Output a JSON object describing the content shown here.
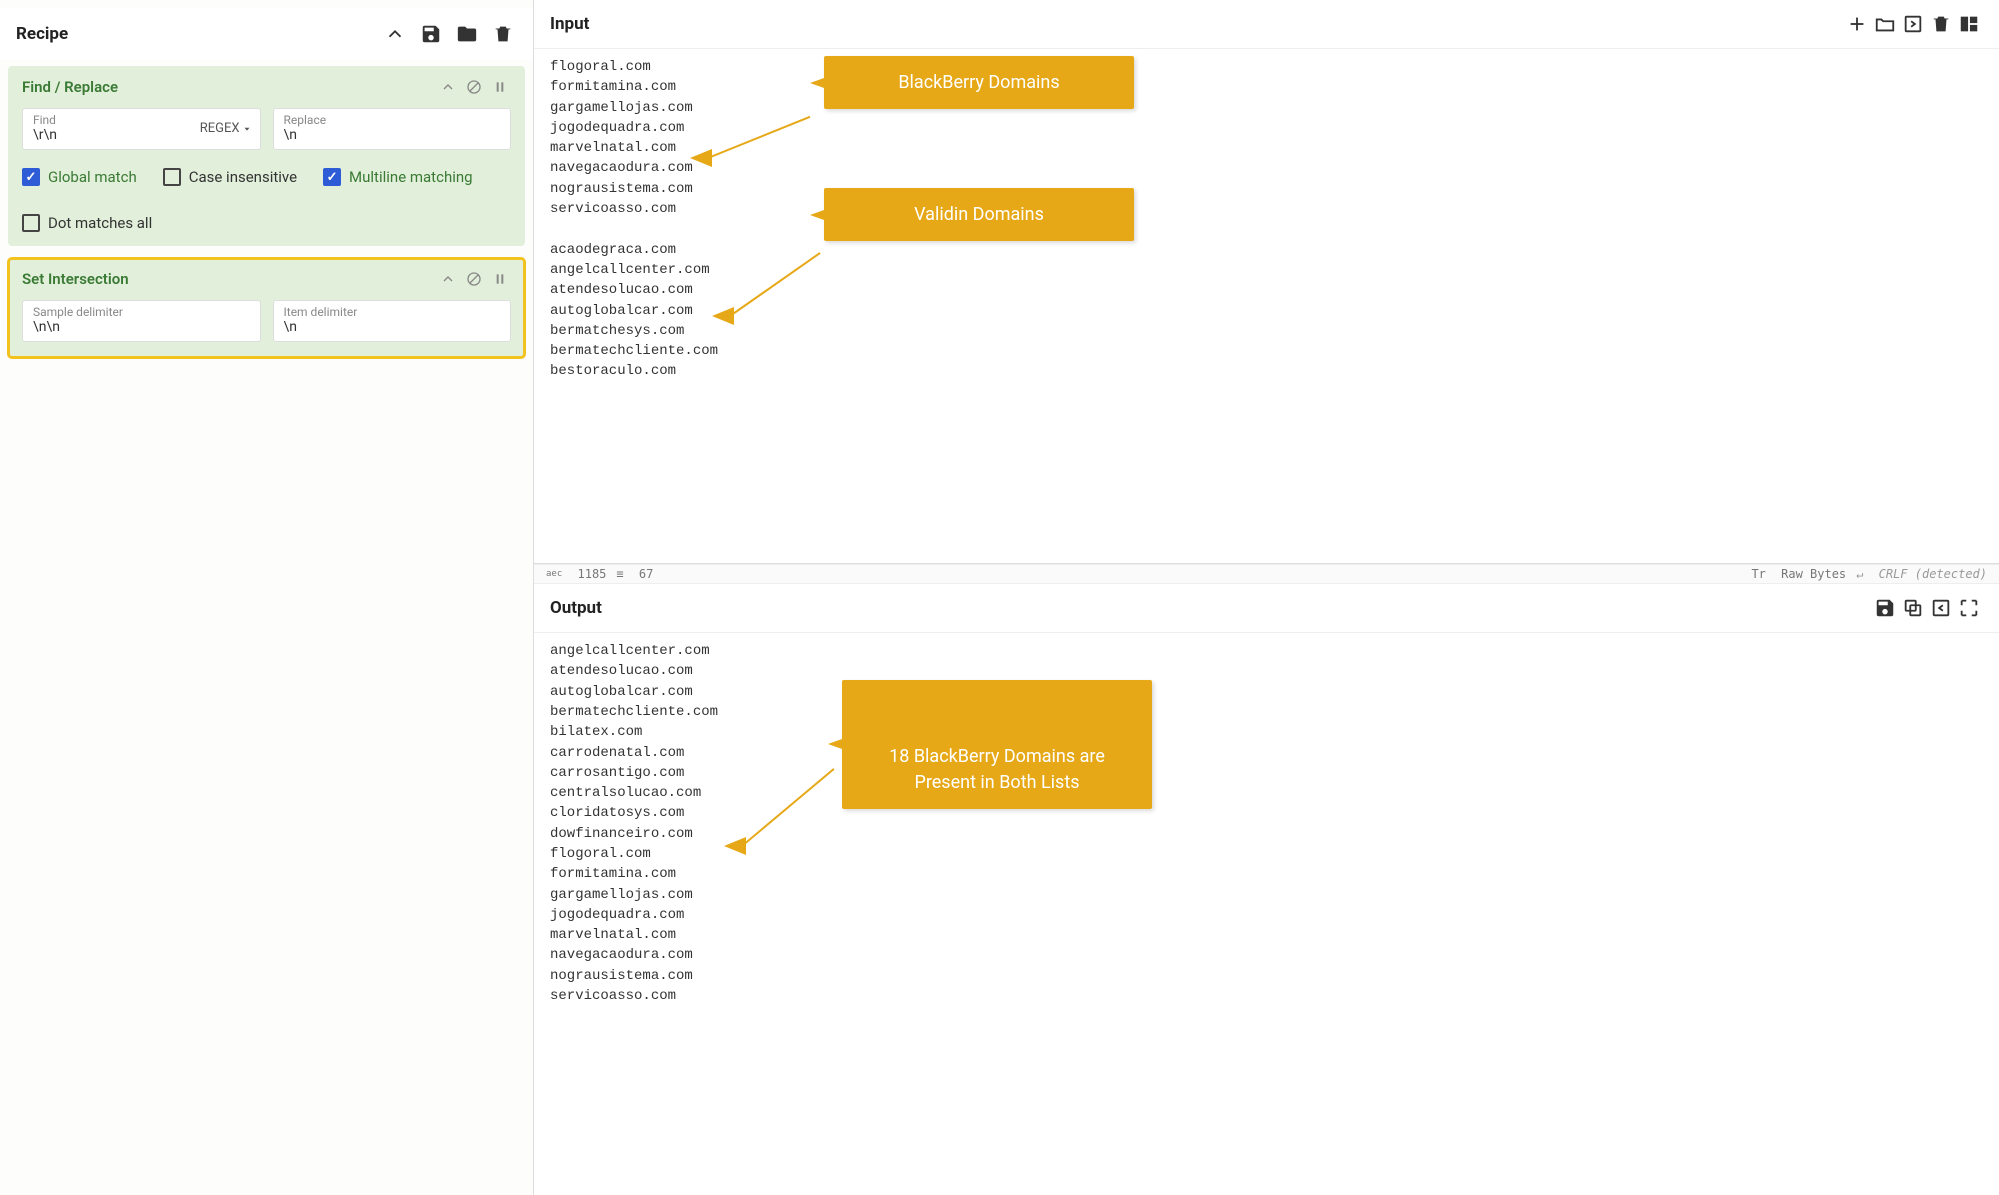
{
  "recipe": {
    "title": "Recipe",
    "ops": [
      {
        "title": "Find / Replace",
        "fields": [
          {
            "label": "Find",
            "value": "\\r\\n",
            "type_label": "REGEX"
          },
          {
            "label": "Replace",
            "value": "\\n"
          }
        ],
        "checks": [
          {
            "label": "Global match",
            "checked": true,
            "tone": "green"
          },
          {
            "label": "Case insensitive",
            "checked": false,
            "tone": "dark"
          },
          {
            "label": "Multiline matching",
            "checked": true,
            "tone": "green"
          },
          {
            "label": "Dot matches all",
            "checked": false,
            "tone": "dark"
          }
        ]
      },
      {
        "title": "Set Intersection",
        "highlighted": true,
        "fields": [
          {
            "label": "Sample delimiter",
            "value": "\\n\\n"
          },
          {
            "label": "Item delimiter",
            "value": "\\n"
          }
        ]
      }
    ]
  },
  "input": {
    "title": "Input",
    "lines": [
      "flogoral.com",
      "formitamina.com",
      "gargamellojas.com",
      "jogodequadra.com",
      "marvelnatal.com",
      "navegacaodura.com",
      "nograusistema.com",
      "servicoasso.com",
      "",
      "acaodegraca.com",
      "angelcallcenter.com",
      "atendesolucao.com",
      "autoglobalcar.com",
      "bermatchesys.com",
      "bermatechcliente.com",
      "bestoraculo.com"
    ],
    "status": {
      "char_count": "1185",
      "line_count": "67",
      "raw_bytes": "Raw Bytes",
      "eol": "CRLF (detected)"
    }
  },
  "output": {
    "title": "Output",
    "lines": [
      "angelcallcenter.com",
      "atendesolucao.com",
      "autoglobalcar.com",
      "bermatechcliente.com",
      "bilatex.com",
      "carrodenatal.com",
      "carrosantigo.com",
      "centralsolucao.com",
      "cloridatosys.com",
      "dowfinanceiro.com",
      "flogoral.com",
      "formitamina.com",
      "gargamellojas.com",
      "jogodequadra.com",
      "marvelnatal.com",
      "navegacaodura.com",
      "nograusistema.com",
      "servicoasso.com"
    ]
  },
  "annotations": {
    "callout1": "BlackBerry Domains",
    "callout2": "Validin Domains",
    "callout3": "18 BlackBerry Domains are\nPresent in Both Lists"
  }
}
